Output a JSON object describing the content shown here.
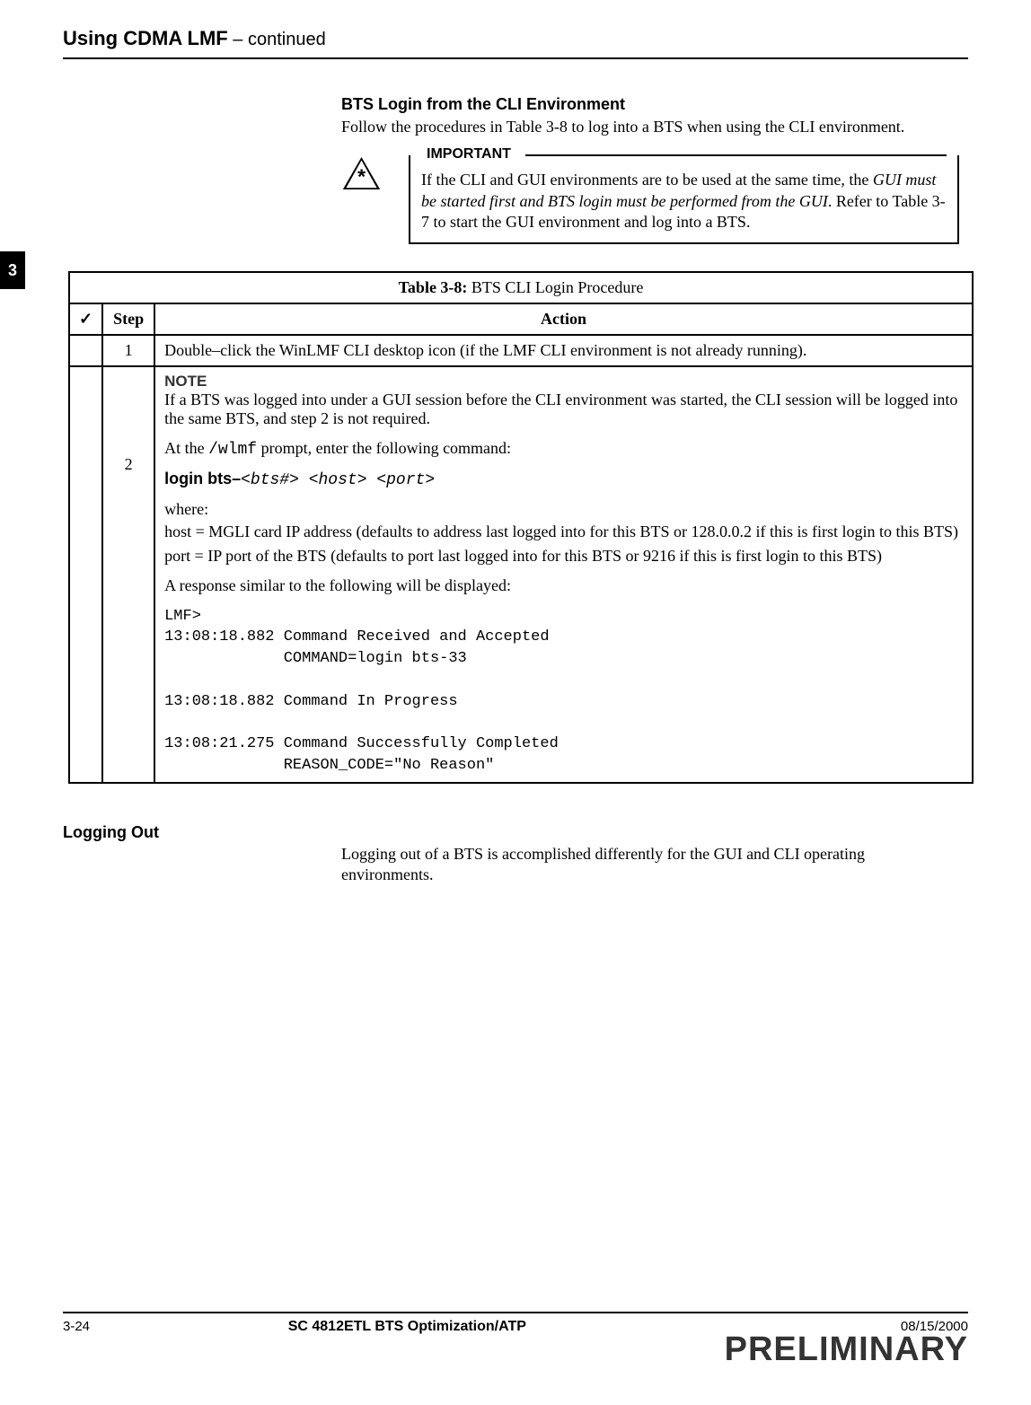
{
  "header": {
    "title_main": "Using CDMA LMF",
    "title_cont": " – continued"
  },
  "chapter_tab": "3",
  "bts_login": {
    "heading": "BTS Login from the CLI Environment",
    "intro": "Follow the procedures in Table 3-8 to log into a BTS when using the CLI environment."
  },
  "important": {
    "label": "IMPORTANT",
    "text_pre": "If the CLI and GUI environments are to be used at the same time, the ",
    "text_em": "GUI must be started first and BTS login must be performed from the GUI",
    "text_post": ". Refer to Table 3-7 to start the GUI environment and log into a BTS."
  },
  "table": {
    "title_bold": "Table 3-8:",
    "title_rest": " BTS CLI Login Procedure",
    "check_header": "✓",
    "step_header": "Step",
    "action_header": "Action",
    "rows": {
      "r1": {
        "step": "1",
        "action": "Double–click the WinLMF CLI desktop icon (if the LMF CLI environment is not already running)."
      },
      "r2": {
        "step": "2",
        "note_label": "NOTE",
        "note_text": "If a BTS was logged into under a GUI session before the CLI environment was started, the CLI session will be logged into the same BTS, and step 2 is not required.",
        "at_pre": "At the ",
        "at_mono": "/wlmf",
        "at_post": " prompt, enter the following command:",
        "login_bold": "login bts–",
        "login_ital": "<bts#>  <host>  <port>",
        "where": "where:",
        "host": "host = MGLI card IP address (defaults to address last logged into for this BTS or 128.0.0.2 if this is first login to this BTS)",
        "port": "port = IP port of the BTS (defaults to port last logged into for this BTS or 9216 if this is first login to this BTS)",
        "response_intro": "A response similar to the following will be displayed:",
        "response_block": "LMF>\n13:08:18.882 Command Received and Accepted\n             COMMAND=login bts-33\n\n13:08:18.882 Command In Progress\n\n13:08:21.275 Command Successfully Completed\n             REASON_CODE=\"No Reason\""
      }
    }
  },
  "logging_out": {
    "heading": "Logging Out",
    "para": "Logging out of a BTS is accomplished differently for the GUI and CLI operating environments."
  },
  "footer": {
    "page": "3-24",
    "center": "SC 4812ETL BTS Optimization/ATP",
    "date": "08/15/2000",
    "watermark": "PRELIMINARY"
  }
}
